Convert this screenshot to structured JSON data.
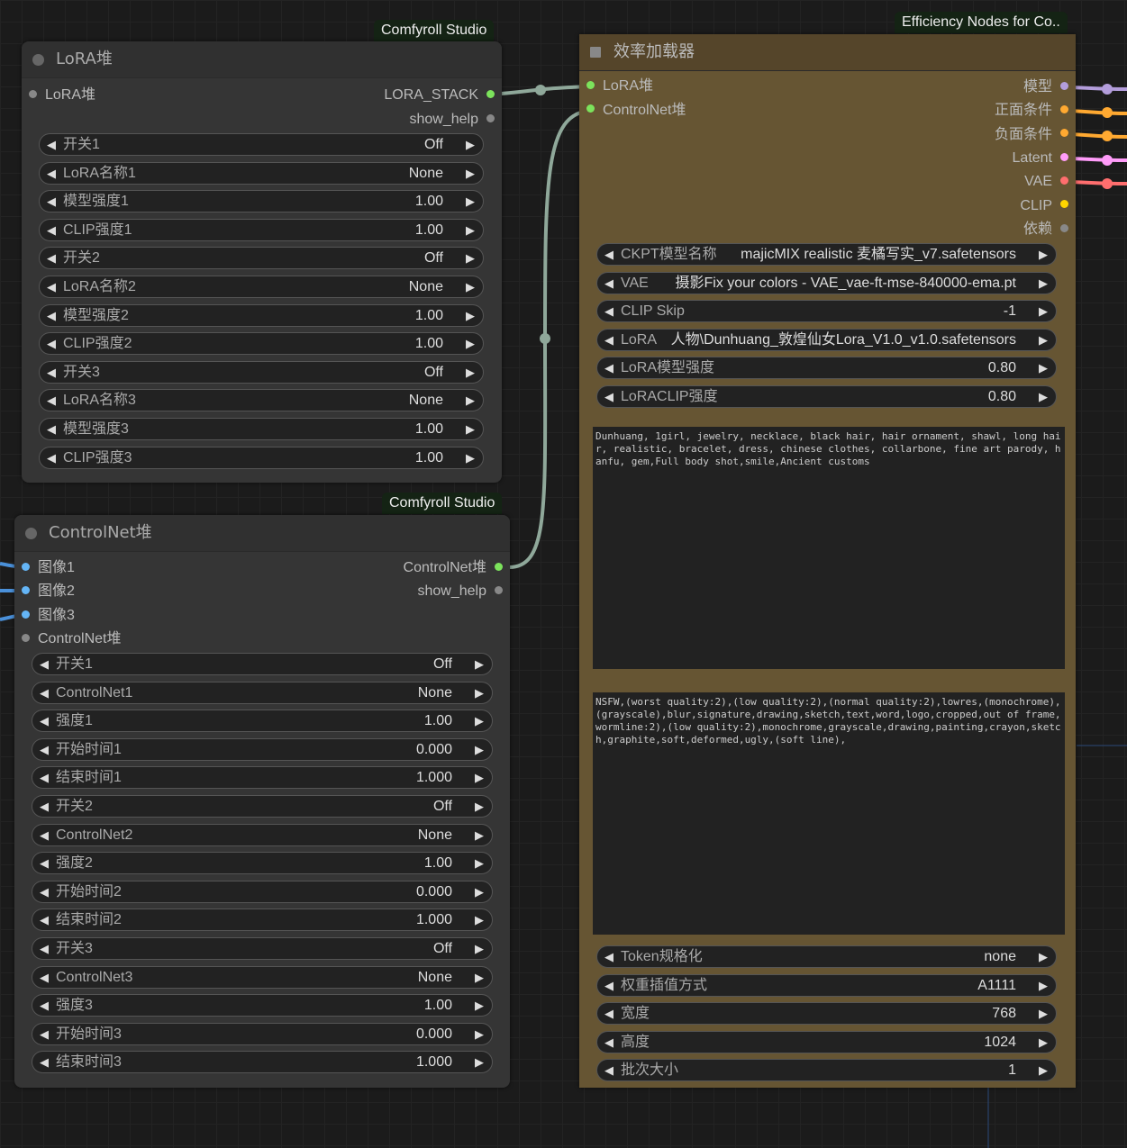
{
  "lora_node": {
    "badge": "Comfyroll Studio",
    "title": "LoRA堆",
    "input": {
      "label": "LoRA堆",
      "color": "#888888"
    },
    "outputs": [
      {
        "label": "LORA_STACK",
        "color": "#7ce35c"
      },
      {
        "label": "show_help",
        "color": "#888888"
      }
    ],
    "widgets": [
      {
        "label": "开关1",
        "value": "Off"
      },
      {
        "label": "LoRA名称1",
        "value": "None"
      },
      {
        "label": "模型强度1",
        "value": "1.00"
      },
      {
        "label": "CLIP强度1",
        "value": "1.00"
      },
      {
        "label": "开关2",
        "value": "Off"
      },
      {
        "label": "LoRA名称2",
        "value": "None"
      },
      {
        "label": "模型强度2",
        "value": "1.00"
      },
      {
        "label": "CLIP强度2",
        "value": "1.00"
      },
      {
        "label": "开关3",
        "value": "Off"
      },
      {
        "label": "LoRA名称3",
        "value": "None"
      },
      {
        "label": "模型强度3",
        "value": "1.00"
      },
      {
        "label": "CLIP强度3",
        "value": "1.00"
      }
    ]
  },
  "controlnet_node": {
    "badge": "Comfyroll Studio",
    "title": "ControlNet堆",
    "inputs": [
      {
        "label": "图像1",
        "color": "#64b5f6"
      },
      {
        "label": "图像2",
        "color": "#64b5f6"
      },
      {
        "label": "图像3",
        "color": "#64b5f6"
      },
      {
        "label": "ControlNet堆",
        "color": "#888888"
      }
    ],
    "outputs": [
      {
        "label": "ControlNet堆",
        "color": "#7ce35c"
      },
      {
        "label": "show_help",
        "color": "#888888"
      }
    ],
    "widgets": [
      {
        "label": "开关1",
        "value": "Off"
      },
      {
        "label": "ControlNet1",
        "value": "None"
      },
      {
        "label": "强度1",
        "value": "1.00"
      },
      {
        "label": "开始时间1",
        "value": "0.000"
      },
      {
        "label": "结束时间1",
        "value": "1.000"
      },
      {
        "label": "开关2",
        "value": "Off"
      },
      {
        "label": "ControlNet2",
        "value": "None"
      },
      {
        "label": "强度2",
        "value": "1.00"
      },
      {
        "label": "开始时间2",
        "value": "0.000"
      },
      {
        "label": "结束时间2",
        "value": "1.000"
      },
      {
        "label": "开关3",
        "value": "Off"
      },
      {
        "label": "ControlNet3",
        "value": "None"
      },
      {
        "label": "强度3",
        "value": "1.00"
      },
      {
        "label": "开始时间3",
        "value": "0.000"
      },
      {
        "label": "结束时间3",
        "value": "1.000"
      }
    ]
  },
  "efficiency_node": {
    "badge": "Efficiency Nodes for Co..",
    "title": "效率加载器",
    "inputs": [
      {
        "label": "LoRA堆",
        "color": "#7ce35c"
      },
      {
        "label": "ControlNet堆",
        "color": "#7ce35c"
      }
    ],
    "outputs": [
      {
        "label": "模型",
        "color": "#b39ddb"
      },
      {
        "label": "正面条件",
        "color": "#ffa931"
      },
      {
        "label": "负面条件",
        "color": "#ffa931"
      },
      {
        "label": "Latent",
        "color": "#ff9cf9"
      },
      {
        "label": "VAE",
        "color": "#ff6e6e"
      },
      {
        "label": "CLIP",
        "color": "#ffd500"
      },
      {
        "label": "依赖",
        "color": "#888888"
      }
    ],
    "widgets_top": [
      {
        "label": "CKPT模型名称",
        "value": "majicMIX realistic 麦橘写实_v7.safetensors"
      },
      {
        "label": "VAE",
        "value": "摄影Fix your colors - VAE_vae-ft-mse-840000-ema.pt"
      },
      {
        "label": "CLIP Skip",
        "value": "-1"
      },
      {
        "label": "LoRA",
        "value": "人物\\Dunhuang_敦煌仙女Lora_V1.0_v1.0.safetensors"
      },
      {
        "label": "LoRA模型强度",
        "value": "0.80"
      },
      {
        "label": "LoRACLIP强度",
        "value": "0.80"
      }
    ],
    "positive_prompt": "Dunhuang, 1girl, jewelry, necklace, black hair, hair ornament, shawl, long hair, realistic, bracelet, dress, chinese clothes, collarbone, fine art parody, hanfu, gem,Full body shot,smile,Ancient customs",
    "negative_prompt": "NSFW,(worst quality:2),(low quality:2),(normal quality:2),lowres,(monochrome),\n(grayscale),blur,signature,drawing,sketch,text,word,logo,cropped,out of frame,wormline:2),(low quality:2),monochrome,grayscale,drawing,painting,crayon,sketch,graphite,soft,deformed,ugly,(soft line),",
    "widgets_bottom": [
      {
        "label": "Token规格化",
        "value": "none"
      },
      {
        "label": "权重插值方式",
        "value": "A1111"
      },
      {
        "label": "宽度",
        "value": "768"
      },
      {
        "label": "高度",
        "value": "1024"
      },
      {
        "label": "批次大小",
        "value": "1"
      }
    ]
  }
}
